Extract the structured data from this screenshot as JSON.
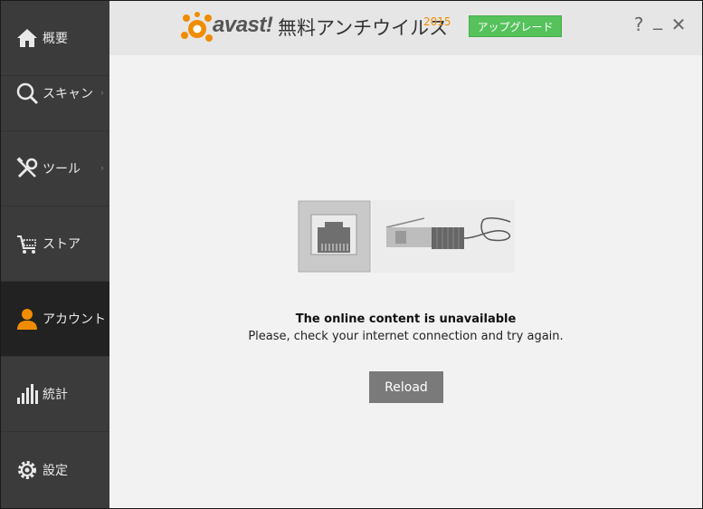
{
  "sidebar": {
    "items": [
      {
        "label": "概要",
        "icon": "home-icon"
      },
      {
        "label": "スキャン",
        "icon": "search-icon",
        "chevron": "›"
      },
      {
        "label": "ツール",
        "icon": "tools-icon",
        "chevron": "›"
      },
      {
        "label": "ストア",
        "icon": "cart-icon"
      },
      {
        "label": "アカウント",
        "icon": "user-icon",
        "active": true
      },
      {
        "label": "統計",
        "icon": "bar-chart-icon"
      },
      {
        "label": "設定",
        "icon": "gear-icon"
      }
    ]
  },
  "header": {
    "logo_text": "avast!",
    "product_name": "無料アンチウイルス",
    "product_year": "2015",
    "upgrade_label": "アップグレード",
    "help": "?",
    "minimize": "_",
    "close": "✕"
  },
  "main": {
    "title": "The online content is unavailable",
    "subtitle": "Please, check your internet connection and try again.",
    "reload_label": "Reload"
  },
  "colors": {
    "sidebar_bg": "#3b3b3b",
    "sidebar_active_bg": "#222222",
    "accent_orange": "#f08c00",
    "upgrade_green": "#55c25c",
    "reload_bg": "#7a7a7a"
  }
}
